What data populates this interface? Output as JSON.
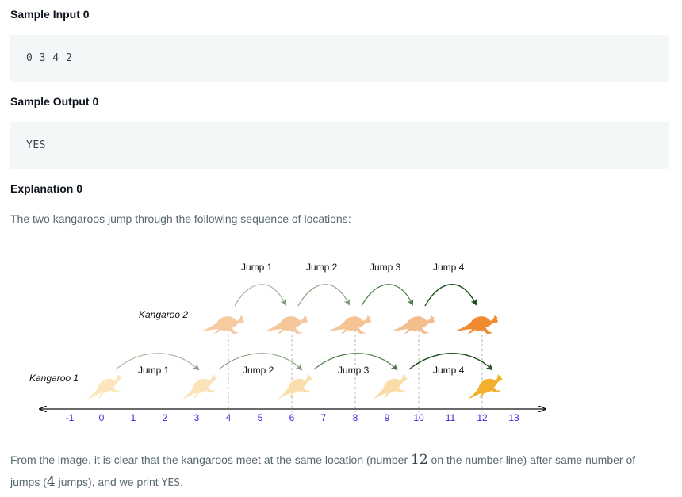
{
  "sample_input": {
    "heading": "Sample Input 0",
    "value": "0 3 4 2"
  },
  "sample_output": {
    "heading": "Sample Output 0",
    "value": "YES"
  },
  "explanation": {
    "heading": "Explanation 0",
    "intro": "The two kangaroos jump through the following sequence of locations:",
    "conclusion_part1": "From the image, it is clear that the kangaroos meet at the same location (number ",
    "meet_number": "12",
    "conclusion_part2": " on the number line) after same number of",
    "conclusion_part3": "jumps (",
    "jump_count": "4",
    "conclusion_part4": " jumps), and we print ",
    "answer": "YES",
    "conclusion_end": "."
  },
  "figure": {
    "kangaroo1_label": "Kangaroo 1",
    "kangaroo2_label": "Kangaroo 2",
    "kangaroo1_start": 0,
    "kangaroo1_step": 3,
    "kangaroo2_start": 4,
    "kangaroo2_step": 2,
    "jump_labels": [
      "Jump 1",
      "Jump 2",
      "Jump 3",
      "Jump 4"
    ],
    "number_line": [
      "-1",
      "0",
      "1",
      "2",
      "3",
      "4",
      "5",
      "6",
      "7",
      "8",
      "9",
      "10",
      "11",
      "12",
      "13"
    ],
    "colors": {
      "tick_label": "#3b1fe0",
      "kangaroo2_light": "#f6c79a",
      "kangaroo2_final": "#ef8a2e",
      "kangaroo1_light": "#fbe3b4",
      "kangaroo1_final": "#f3b02c",
      "arrow_light": "#a7b9a2",
      "arrow_dark": "#1e4d1e"
    }
  }
}
